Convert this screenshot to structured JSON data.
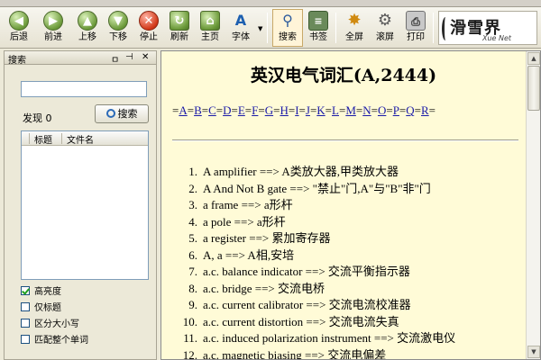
{
  "window": {
    "title": ""
  },
  "toolbar": {
    "back": "后退",
    "forward": "前进",
    "up": "上移",
    "down": "下移",
    "stop": "停止",
    "refresh": "刷新",
    "home": "主页",
    "font": "字体",
    "search": "搜索",
    "bookmark": "书签",
    "fullscreen": "全屏",
    "scroll": "滚屏",
    "print": "打印",
    "logo_text": "滑雪界",
    "logo_sub": "Xue Net"
  },
  "search_panel": {
    "title": "搜索",
    "pin_glyph": "ㅁ",
    "close_glyph": "✕",
    "query_value": "",
    "found_label": "发现",
    "found_count": "0",
    "search_button": "搜索",
    "col_title": "标题",
    "col_file": "文件名",
    "options": [
      {
        "label": "高亮度",
        "checked": true
      },
      {
        "label": "仅标题",
        "checked": false
      },
      {
        "label": "区分大小写",
        "checked": false
      },
      {
        "label": "匹配整个单词",
        "checked": false
      }
    ]
  },
  "document": {
    "title": "英汉电气词汇(A,2444)",
    "alphabet": [
      "A",
      "B",
      "C",
      "D",
      "E",
      "F",
      "G",
      "H",
      "I",
      "J",
      "K",
      "L",
      "M",
      "N",
      "O",
      "P",
      "Q",
      "R"
    ],
    "entries": [
      {
        "num": "1.",
        "text": "A amplifier ==> A类放大器,甲类放大器"
      },
      {
        "num": "2.",
        "text": "A And Not B gate ==> \"禁止\"门,A\"与\"B\"非\"门"
      },
      {
        "num": "3.",
        "text": "a frame ==> a形杆"
      },
      {
        "num": "4.",
        "text": "a pole ==> a形杆"
      },
      {
        "num": "5.",
        "text": "a register ==> 累加寄存器"
      },
      {
        "num": "6.",
        "text": "A, a ==> A相,安培"
      },
      {
        "num": "7.",
        "text": "a.c. balance indicator ==> 交流平衡指示器"
      },
      {
        "num": "8.",
        "text": "a.c. bridge ==> 交流电桥"
      },
      {
        "num": "9.",
        "text": "a.c. current calibrator ==> 交流电流校准器"
      },
      {
        "num": "10.",
        "text": "a.c. current distortion ==> 交流电流失真"
      },
      {
        "num": "11.",
        "text": "a.c. induced polarization instrument ==> 交流激电仪"
      },
      {
        "num": "12.",
        "text": "a.c. magnetic biasing ==> 交流电偏差"
      }
    ]
  }
}
